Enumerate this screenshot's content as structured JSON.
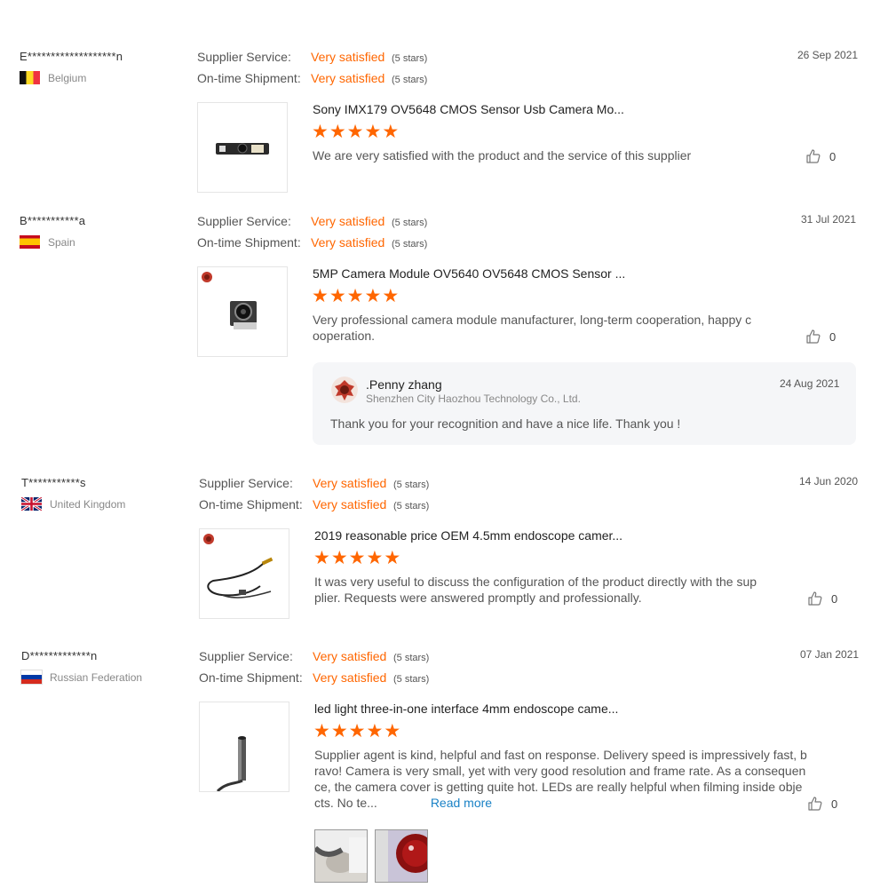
{
  "labels": {
    "supplier_service": "Supplier Service:",
    "ontime_shipment": "On-time Shipment:",
    "read_more": "Read more"
  },
  "reviews": [
    {
      "buyer": "E*******************n",
      "country": "Belgium",
      "supplier_service": "Very satisfied",
      "supplier_service_stars": "(5 stars)",
      "ontime_shipment": "Very satisfied",
      "ontime_shipment_stars": "(5 stars)",
      "date": "26 Sep 2021",
      "product_title": "Sony IMX179 OV5648 CMOS Sensor Usb Camera Mo...",
      "rating": 5,
      "text": "We are very satisfied with the product and the service of this supplier",
      "likes": "0"
    },
    {
      "buyer": "B***********a",
      "country": "Spain",
      "supplier_service": "Very satisfied",
      "supplier_service_stars": "(5 stars)",
      "ontime_shipment": "Very satisfied",
      "ontime_shipment_stars": "(5 stars)",
      "date": "31 Jul 2021",
      "product_title": "5MP Camera Module OV5640 OV5648 CMOS Sensor ...",
      "rating": 5,
      "text": "Very professional camera module manufacturer, long-term cooperation, happy cooperation.",
      "likes": "0",
      "reply": {
        "name": ".Penny zhang",
        "company": "Shenzhen City Haozhou Technology Co., Ltd.",
        "date": "24 Aug 2021",
        "text": "Thank you for your recognition and have a nice life. Thank you !"
      }
    },
    {
      "buyer": "T***********s",
      "country": "United Kingdom",
      "supplier_service": "Very satisfied",
      "supplier_service_stars": "(5 stars)",
      "ontime_shipment": "Very satisfied",
      "ontime_shipment_stars": "(5 stars)",
      "date": "14 Jun 2020",
      "product_title": "2019 reasonable price OEM 4.5mm endoscope camer...",
      "rating": 5,
      "text": "It was very useful to discuss the configuration of the product directly with the supplier. Requests were answered promptly and professionally.",
      "likes": "0"
    },
    {
      "buyer": "D*************n",
      "country": "Russian Federation",
      "supplier_service": "Very satisfied",
      "supplier_service_stars": "(5 stars)",
      "ontime_shipment": "Very satisfied",
      "ontime_shipment_stars": "(5 stars)",
      "date": "07 Jan 2021",
      "product_title": "led light three-in-one interface 4mm endoscope came...",
      "rating": 5,
      "text": "Supplier agent is kind, helpful and fast on response. Delivery speed is impressively fast, bravo! Camera is very small, yet with very good resolution and frame rate. As a consequence, the camera cover is getting quite hot. LEDs are really helpful when filming inside objects. No te...",
      "likes": "0"
    }
  ],
  "colors": {
    "accent": "#ff6600",
    "link": "#1a82c6",
    "reply_bg": "#f5f6f8"
  }
}
